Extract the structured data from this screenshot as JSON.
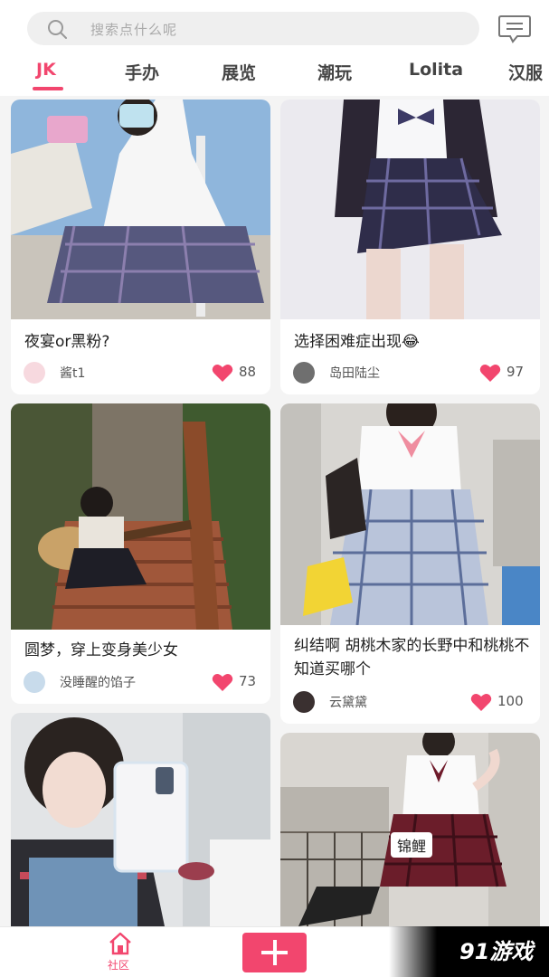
{
  "header": {
    "search_placeholder": "搜索点什么呢",
    "tabs": [
      "JK",
      "手办",
      "展览",
      "潮玩",
      "Lolita",
      "汉服"
    ],
    "active_tab": "JK"
  },
  "colors": {
    "accent": "#f2466e"
  },
  "feed": [
    {
      "title": "夜宴or黑粉?",
      "author": "酱t1",
      "likes": "88"
    },
    {
      "title": "选择困难症出现😂",
      "author": "岛田陆尘",
      "likes": "97"
    },
    {
      "title": "圆梦，穿上变身美少女",
      "author": "没睡醒的馅子",
      "likes": "73"
    },
    {
      "title": "纠结啊 胡桃木家的长野中和桃桃不知道买哪个",
      "author": "云黛黛",
      "likes": "100"
    },
    {
      "title": "",
      "author": "",
      "likes": ""
    },
    {
      "title": "",
      "author": "",
      "likes": "",
      "tag": "锦鲤"
    }
  ],
  "bottom_nav": {
    "home_label": "社区"
  },
  "watermark": "91游戏",
  "icons": [
    "search-icon",
    "message-icon",
    "heart-icon",
    "home-icon",
    "plus-icon"
  ]
}
